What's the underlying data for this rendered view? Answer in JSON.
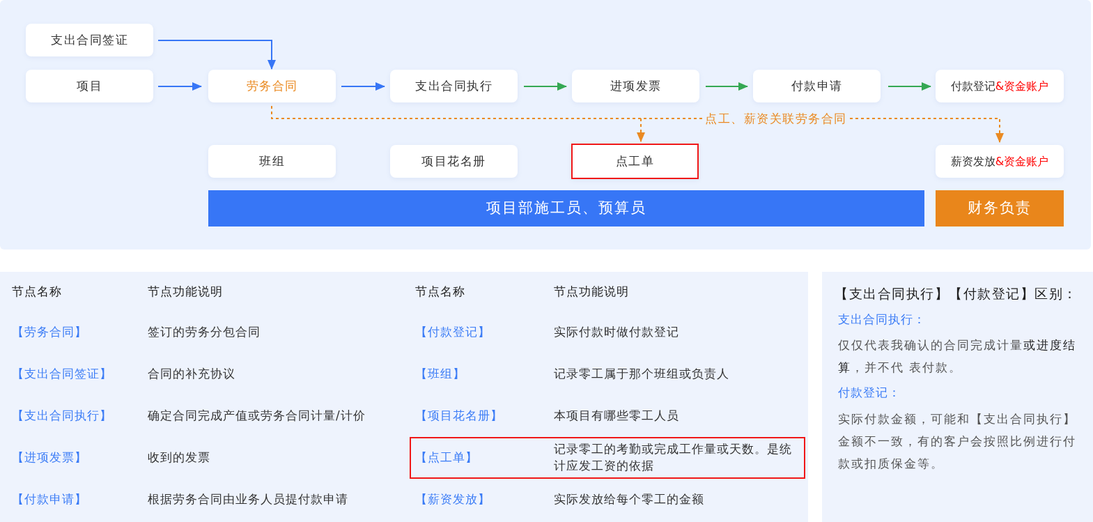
{
  "diagram": {
    "nodes": [
      {
        "label": "支出合同签证",
        "kind": "plain",
        "highlighted": false
      },
      {
        "label": "项目",
        "kind": "plain",
        "highlighted": false
      },
      {
        "label": "劳务合同",
        "kind": "accent",
        "highlighted": false
      },
      {
        "label": "支出合同执行",
        "kind": "plain",
        "highlighted": false
      },
      {
        "label": "进项发票",
        "kind": "plain",
        "highlighted": false
      },
      {
        "label": "付款申请",
        "kind": "plain",
        "highlighted": false
      },
      {
        "label": "付款登记",
        "suffix": "&资金账户",
        "kind": "plain",
        "highlighted": false
      },
      {
        "label": "班组",
        "kind": "plain",
        "highlighted": false
      },
      {
        "label": "项目花名册",
        "kind": "plain",
        "highlighted": false
      },
      {
        "label": "点工单",
        "kind": "plain",
        "highlighted": true
      },
      {
        "label": "薪资发放",
        "suffix": "&资金账户",
        "kind": "plain",
        "highlighted": false
      }
    ],
    "link_label": "点工、薪资关联劳务合同",
    "roles": [
      {
        "label": "项目部施工员、预算员",
        "color": "#3776f6"
      },
      {
        "label": "财务负责",
        "color": "#e9861b"
      }
    ]
  },
  "tables": [
    {
      "columns": [
        "节点名称",
        "节点功能说明"
      ],
      "rows": [
        {
          "node": "【劳务合同】",
          "description": "签订的劳务分包合同",
          "highlighted": false
        },
        {
          "node": "【支出合同签证】",
          "description": "合同的补充协议",
          "highlighted": false
        },
        {
          "node": "【支出合同执行】",
          "description": "确定合同完成产值或劳务合同计量/计价",
          "highlighted": false
        },
        {
          "node": "【进项发票】",
          "description": "收到的发票",
          "highlighted": false
        },
        {
          "node": "【付款申请】",
          "description": "根据劳务合同由业务人员提付款申请",
          "highlighted": false
        }
      ]
    },
    {
      "columns": [
        "节点名称",
        "节点功能说明"
      ],
      "rows": [
        {
          "node": "【付款登记】",
          "description": "实际付款时做付款登记",
          "highlighted": false
        },
        {
          "node": "【班组】",
          "description": "记录零工属于那个班组或负责人",
          "highlighted": false
        },
        {
          "node": "【项目花名册】",
          "description": "本项目有哪些零工人员",
          "highlighted": false
        },
        {
          "node": "【点工单】",
          "description": "记录零工的考勤或完成工作量或天数。是统计应发工资的依据",
          "highlighted": true
        },
        {
          "node": "【薪资发放】",
          "description": "实际发放给每个零工的金额",
          "highlighted": false
        }
      ]
    }
  ],
  "notes": {
    "title": "【支出合同执行】【付款登记】区别：",
    "sections": [
      {
        "heading": "支出合同执行：",
        "text": "仅仅代表我确认的合同完成计量**或进度结算**，并不代 表付款。"
      },
      {
        "heading": "付款登记：",
        "text": "实际付款金额，可能和【支出合同执行】金额不一致，有的客户会按照比例进行付款或扣质保金等。"
      }
    ]
  }
}
